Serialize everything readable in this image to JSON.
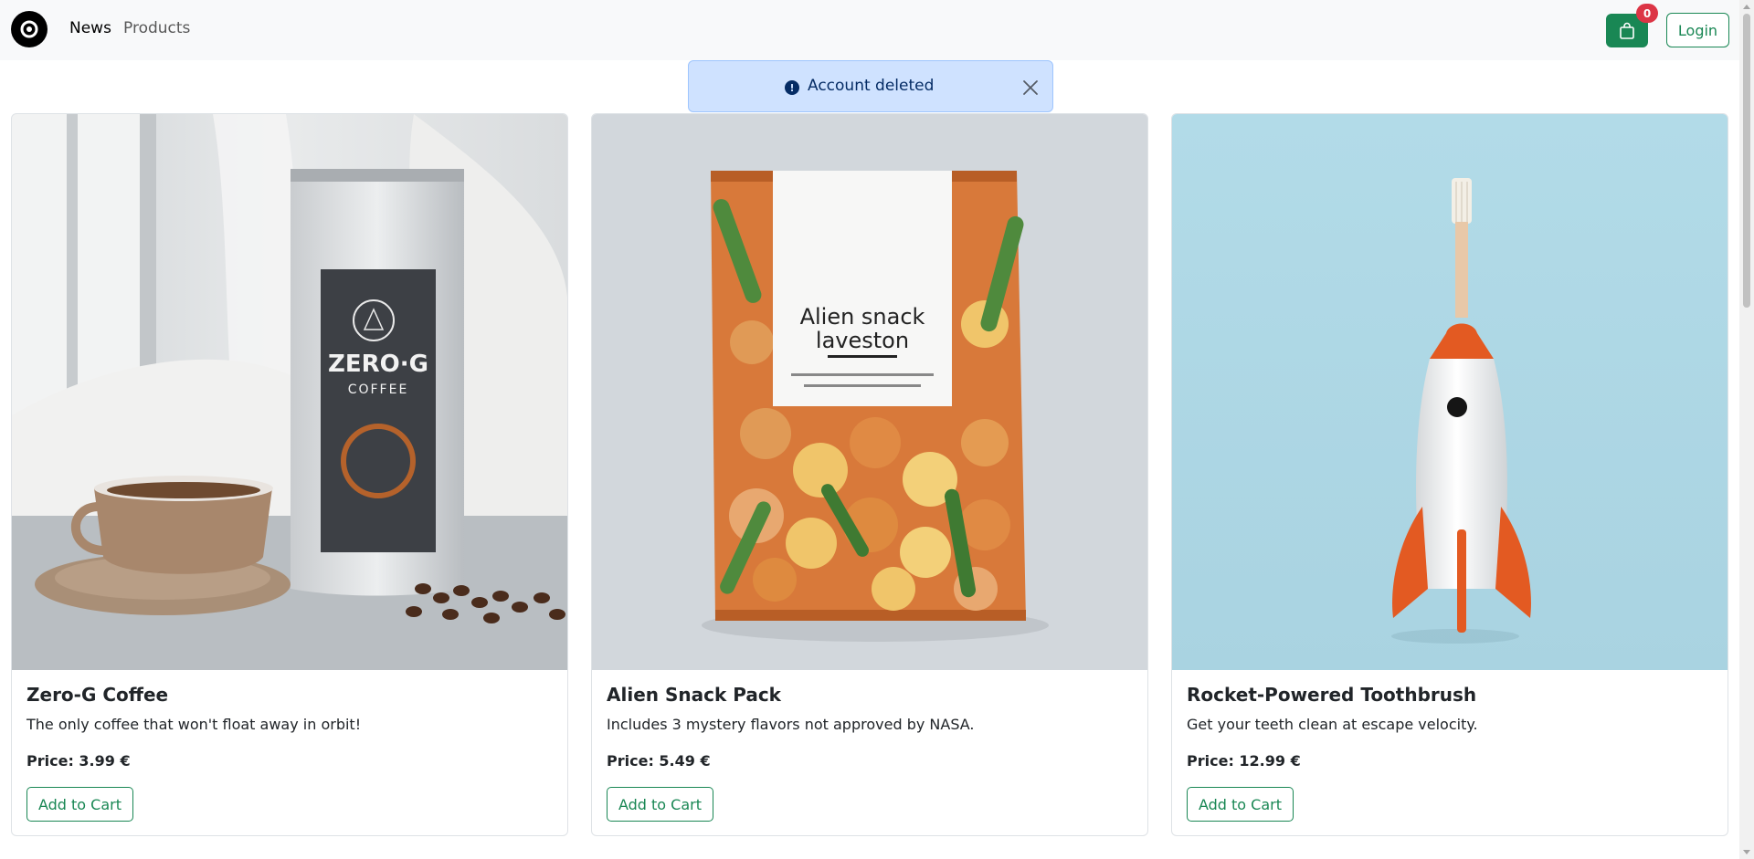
{
  "nav": {
    "logo_icon": "target-logo-icon",
    "links": [
      "News",
      "Products"
    ],
    "cart_icon": "shopping-bag-icon",
    "cart_count": "0",
    "login_label": "Login"
  },
  "alert": {
    "icon": "exclamation-circle-icon",
    "message": "Account deleted",
    "close_icon": "close-icon"
  },
  "products": [
    {
      "title": "Zero-G Coffee",
      "description": "The only coffee that won't float away in orbit!",
      "price": "Price: 3.99 €",
      "button": "Add to Cart",
      "package_brand": "ZERO·G",
      "package_sub": "COFFEE"
    },
    {
      "title": "Alien Snack Pack",
      "description": "Includes 3 mystery flavors not approved by NASA.",
      "price": "Price: 5.49 €",
      "button": "Add to Cart",
      "package_line1": "Alien snack",
      "package_line2": "laveston"
    },
    {
      "title": "Rocket-Powered Toothbrush",
      "description": "Get your teeth clean at escape velocity.",
      "price": "Price: 12.99 €",
      "button": "Add to Cart"
    }
  ],
  "colors": {
    "primary": "#198754",
    "badge": "#dc3545",
    "alert_bg": "#cfe2ff",
    "alert_text": "#052c65",
    "navbar_bg": "#f8f9fa"
  }
}
